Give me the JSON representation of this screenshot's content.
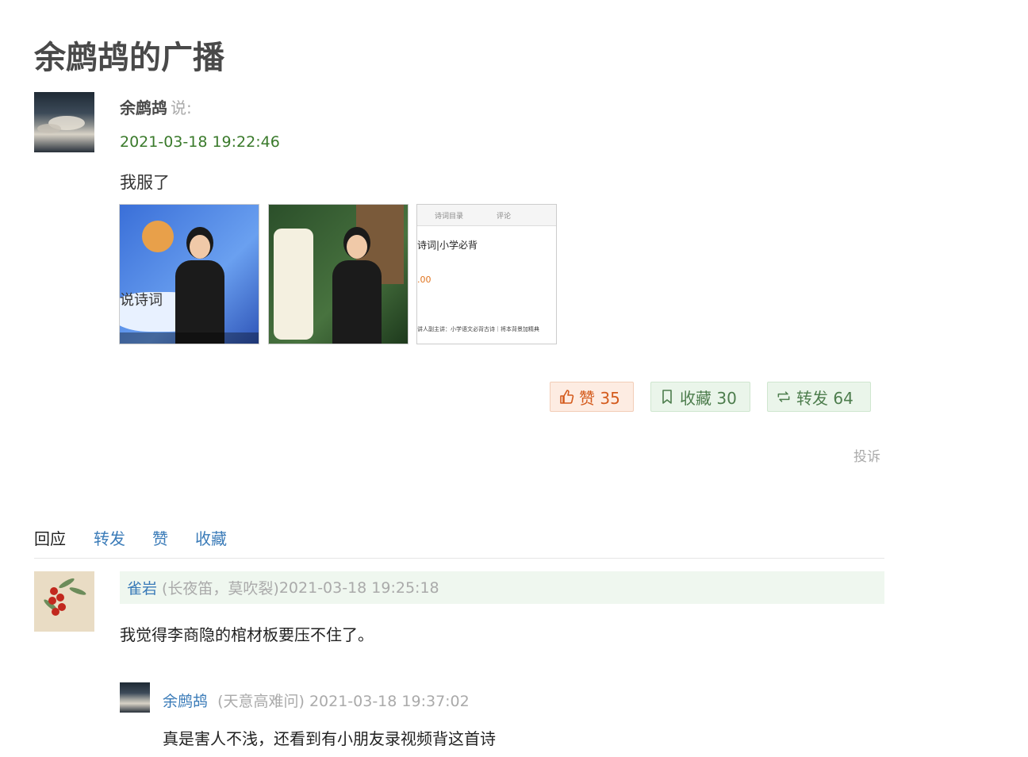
{
  "page": {
    "title": "余鹧鸪的广播"
  },
  "status": {
    "author": "余鹧鸪",
    "said": "说:",
    "time": "2021-03-18 19:22:46",
    "text": "我服了",
    "images": [
      {
        "caption": "说诗词"
      },
      {
        "caption": ""
      },
      {
        "tab1": "诗词目录",
        "tab2": "评论",
        "title": "诗词|小学必背",
        "price": ".00",
        "line": "讲人副主讲：小学语文必背古诗｜将本背景加精典"
      }
    ]
  },
  "actions": {
    "like_label": "赞 35",
    "collect_label": "收藏 30",
    "reshare_label": "转发 64",
    "report": "投诉"
  },
  "tabs": [
    "回应",
    "转发",
    "赞",
    "收藏"
  ],
  "comments": [
    {
      "name": "雀岩",
      "meta": "(长夜笛，莫吹裂)",
      "time": "2021-03-18 19:25:18",
      "text": "我觉得李商隐的棺材板要压不住了。"
    },
    {
      "name": "余鹧鸪",
      "meta": "(天意高难问)",
      "time": "2021-03-18 19:37:02",
      "text": "真是害人不浅，还看到有小朋友录视频背这首诗"
    }
  ],
  "colors": {
    "link": "#3a7bb8",
    "time_green": "#3a7a2b",
    "like": "#d45b1d",
    "green_btn": "#4d7d4d"
  },
  "icons": [
    "thumbs-up-icon",
    "bookmark-icon",
    "reshare-icon"
  ]
}
